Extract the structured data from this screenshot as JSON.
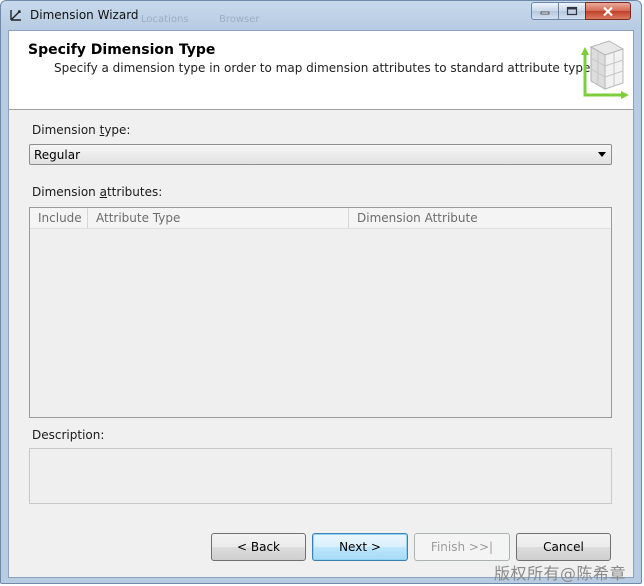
{
  "window": {
    "title": "Dimension Wizard",
    "ghost_items": [
      "Locations",
      "Browser"
    ],
    "controls": {
      "minimize": "minimize",
      "maximize": "maximize",
      "close": "close"
    }
  },
  "header": {
    "title": "Specify Dimension Type",
    "subtitle": "Specify a dimension type in order to map dimension attributes to standard attribute types."
  },
  "dimension_type": {
    "label_before": "Dimension ",
    "label_access": "t",
    "label_after": "ype:",
    "selected": "Regular"
  },
  "dimension_attributes": {
    "label_before": "Dimension ",
    "label_access": "a",
    "label_after": "ttributes:",
    "columns": [
      "Include",
      "Attribute Type",
      "Dimension Attribute"
    ],
    "rows": []
  },
  "description": {
    "label": "Description:",
    "text": ""
  },
  "buttons": {
    "back": "< Back",
    "next": "Next >",
    "finish": "Finish >>|",
    "cancel": "Cancel"
  },
  "watermark": "版权所有@陈希章",
  "colors": {
    "title_bar": "#c8d9ec",
    "client_bg": "#f0f0f0",
    "close_button": "#c2402a",
    "default_button_border": "#3c7fb1",
    "header_image_accent": "#7ccf3a"
  }
}
